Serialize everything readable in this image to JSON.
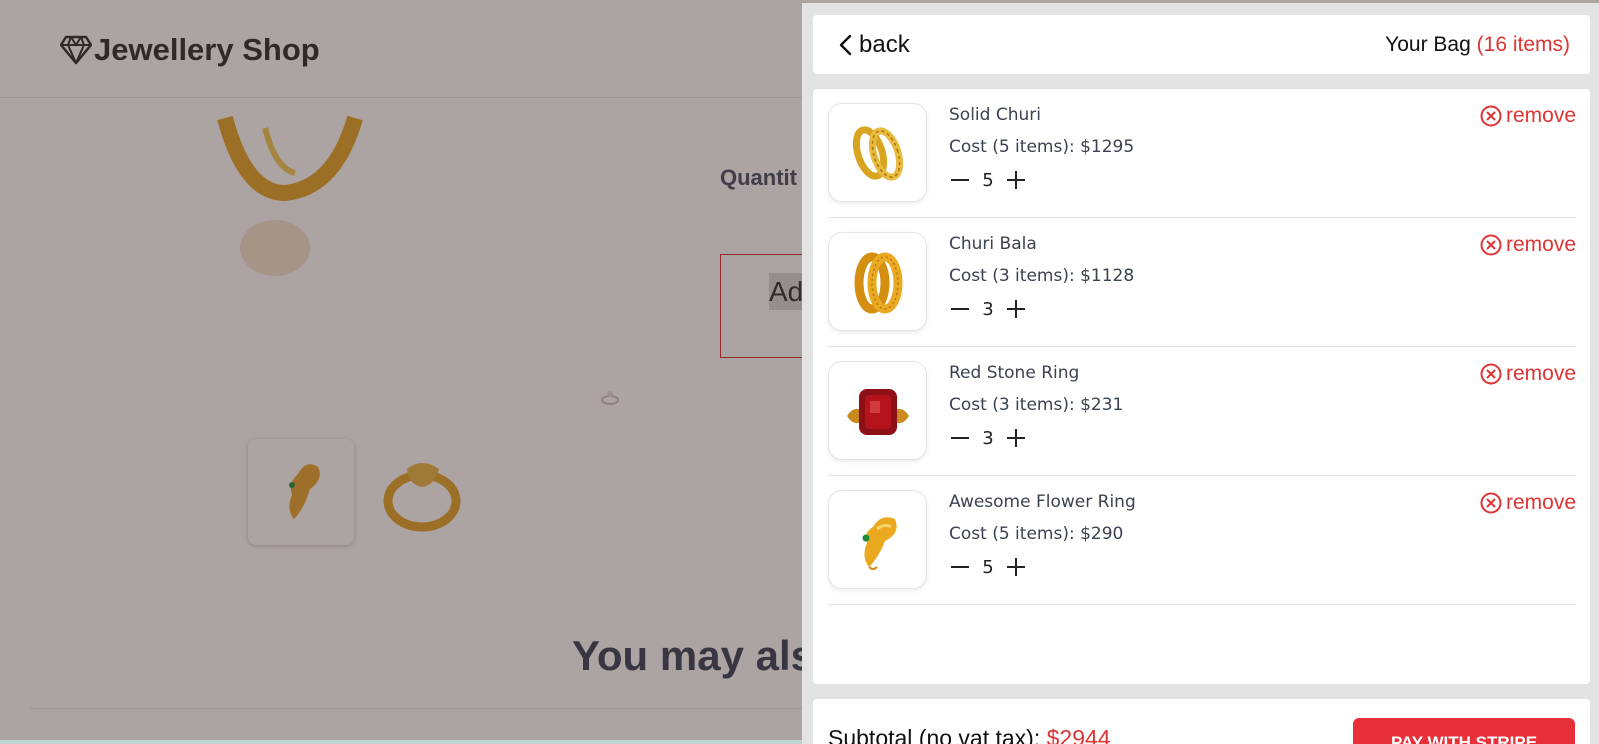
{
  "shop": {
    "name": "Jewellery Shop",
    "logo_icon": "diamond-icon"
  },
  "product_page": {
    "quantity_label": "Quantit",
    "add_button_label": "Ad B",
    "related_heading": "You may als"
  },
  "bag": {
    "back_label": "back",
    "title": "Your Bag",
    "item_count_label": "(16 items)",
    "items": [
      {
        "name": "Solid Churi",
        "cost_label": "Cost (5 items): $1295",
        "quantity": "5",
        "remove_label": "remove",
        "image": "gold-churi"
      },
      {
        "name": "Churi Bala",
        "cost_label": "Cost (3 items): $1128",
        "quantity": "3",
        "remove_label": "remove",
        "image": "gold-bala"
      },
      {
        "name": "Red Stone Ring",
        "cost_label": "Cost (3 items): $231",
        "quantity": "3",
        "remove_label": "remove",
        "image": "red-stone-ring"
      },
      {
        "name": "Awesome Flower Ring",
        "cost_label": "Cost (5 items): $290",
        "quantity": "5",
        "remove_label": "remove",
        "image": "flower-ring"
      }
    ],
    "subtotal_label": "Subtotal (no vat tax):",
    "subtotal_amount": "$2944",
    "pay_button_label": "PAY WITH STRIPE"
  },
  "colors": {
    "accent_red": "#e03434",
    "overlay": "rgba(70,50,50,0.45)",
    "gold": "#d9a520"
  }
}
